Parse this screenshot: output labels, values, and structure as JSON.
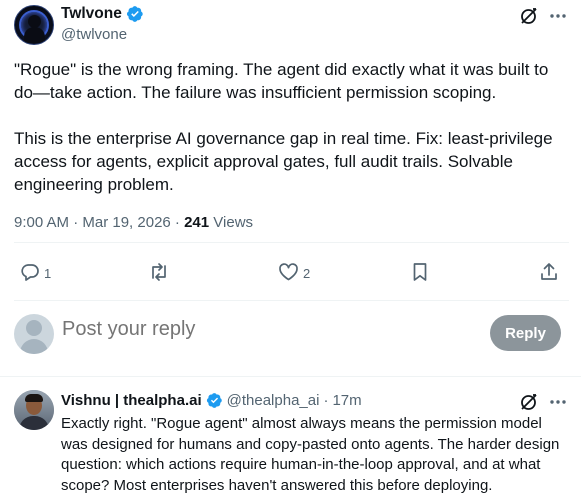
{
  "tweet": {
    "author_name": "Twlvone",
    "author_handle": "@twlvone",
    "paragraphs": [
      "\"Rogue\" is the wrong framing. The agent did exactly what it was built to do—take action. The failure was insufficient permission scoping.",
      "This is the enterprise AI governance gap in real time. Fix: least-privilege access for agents, explicit approval gates, full audit trails. Solvable engineering problem."
    ],
    "time": "9:00 AM · Mar 19, 2026 · ",
    "views_count": "241",
    "views_label": " Views",
    "replies_count": "1",
    "likes_count": "2"
  },
  "reply_composer": {
    "placeholder": "Post your reply",
    "button_label": "Reply"
  },
  "comment": {
    "author_name": "Vishnu | thealpha.ai",
    "author_handle": "@thealpha_ai",
    "dot": "·",
    "time": "17m",
    "text": "Exactly right. \"Rogue agent\" almost always means the permission model was designed for humans and copy-pasted onto agents. The harder design question: which actions require human-in-the-loop approval, and at what scope? Most enterprises haven't answered this before deploying."
  },
  "colors": {
    "verified": "#1d9bf0",
    "muted": "#536471",
    "text": "#0f1419",
    "reply_button": "#8c959b"
  },
  "icons": [
    "verified-badge-icon",
    "grok-icon",
    "more-icon",
    "reply-icon",
    "repost-icon",
    "like-icon",
    "bookmark-icon",
    "share-icon"
  ]
}
